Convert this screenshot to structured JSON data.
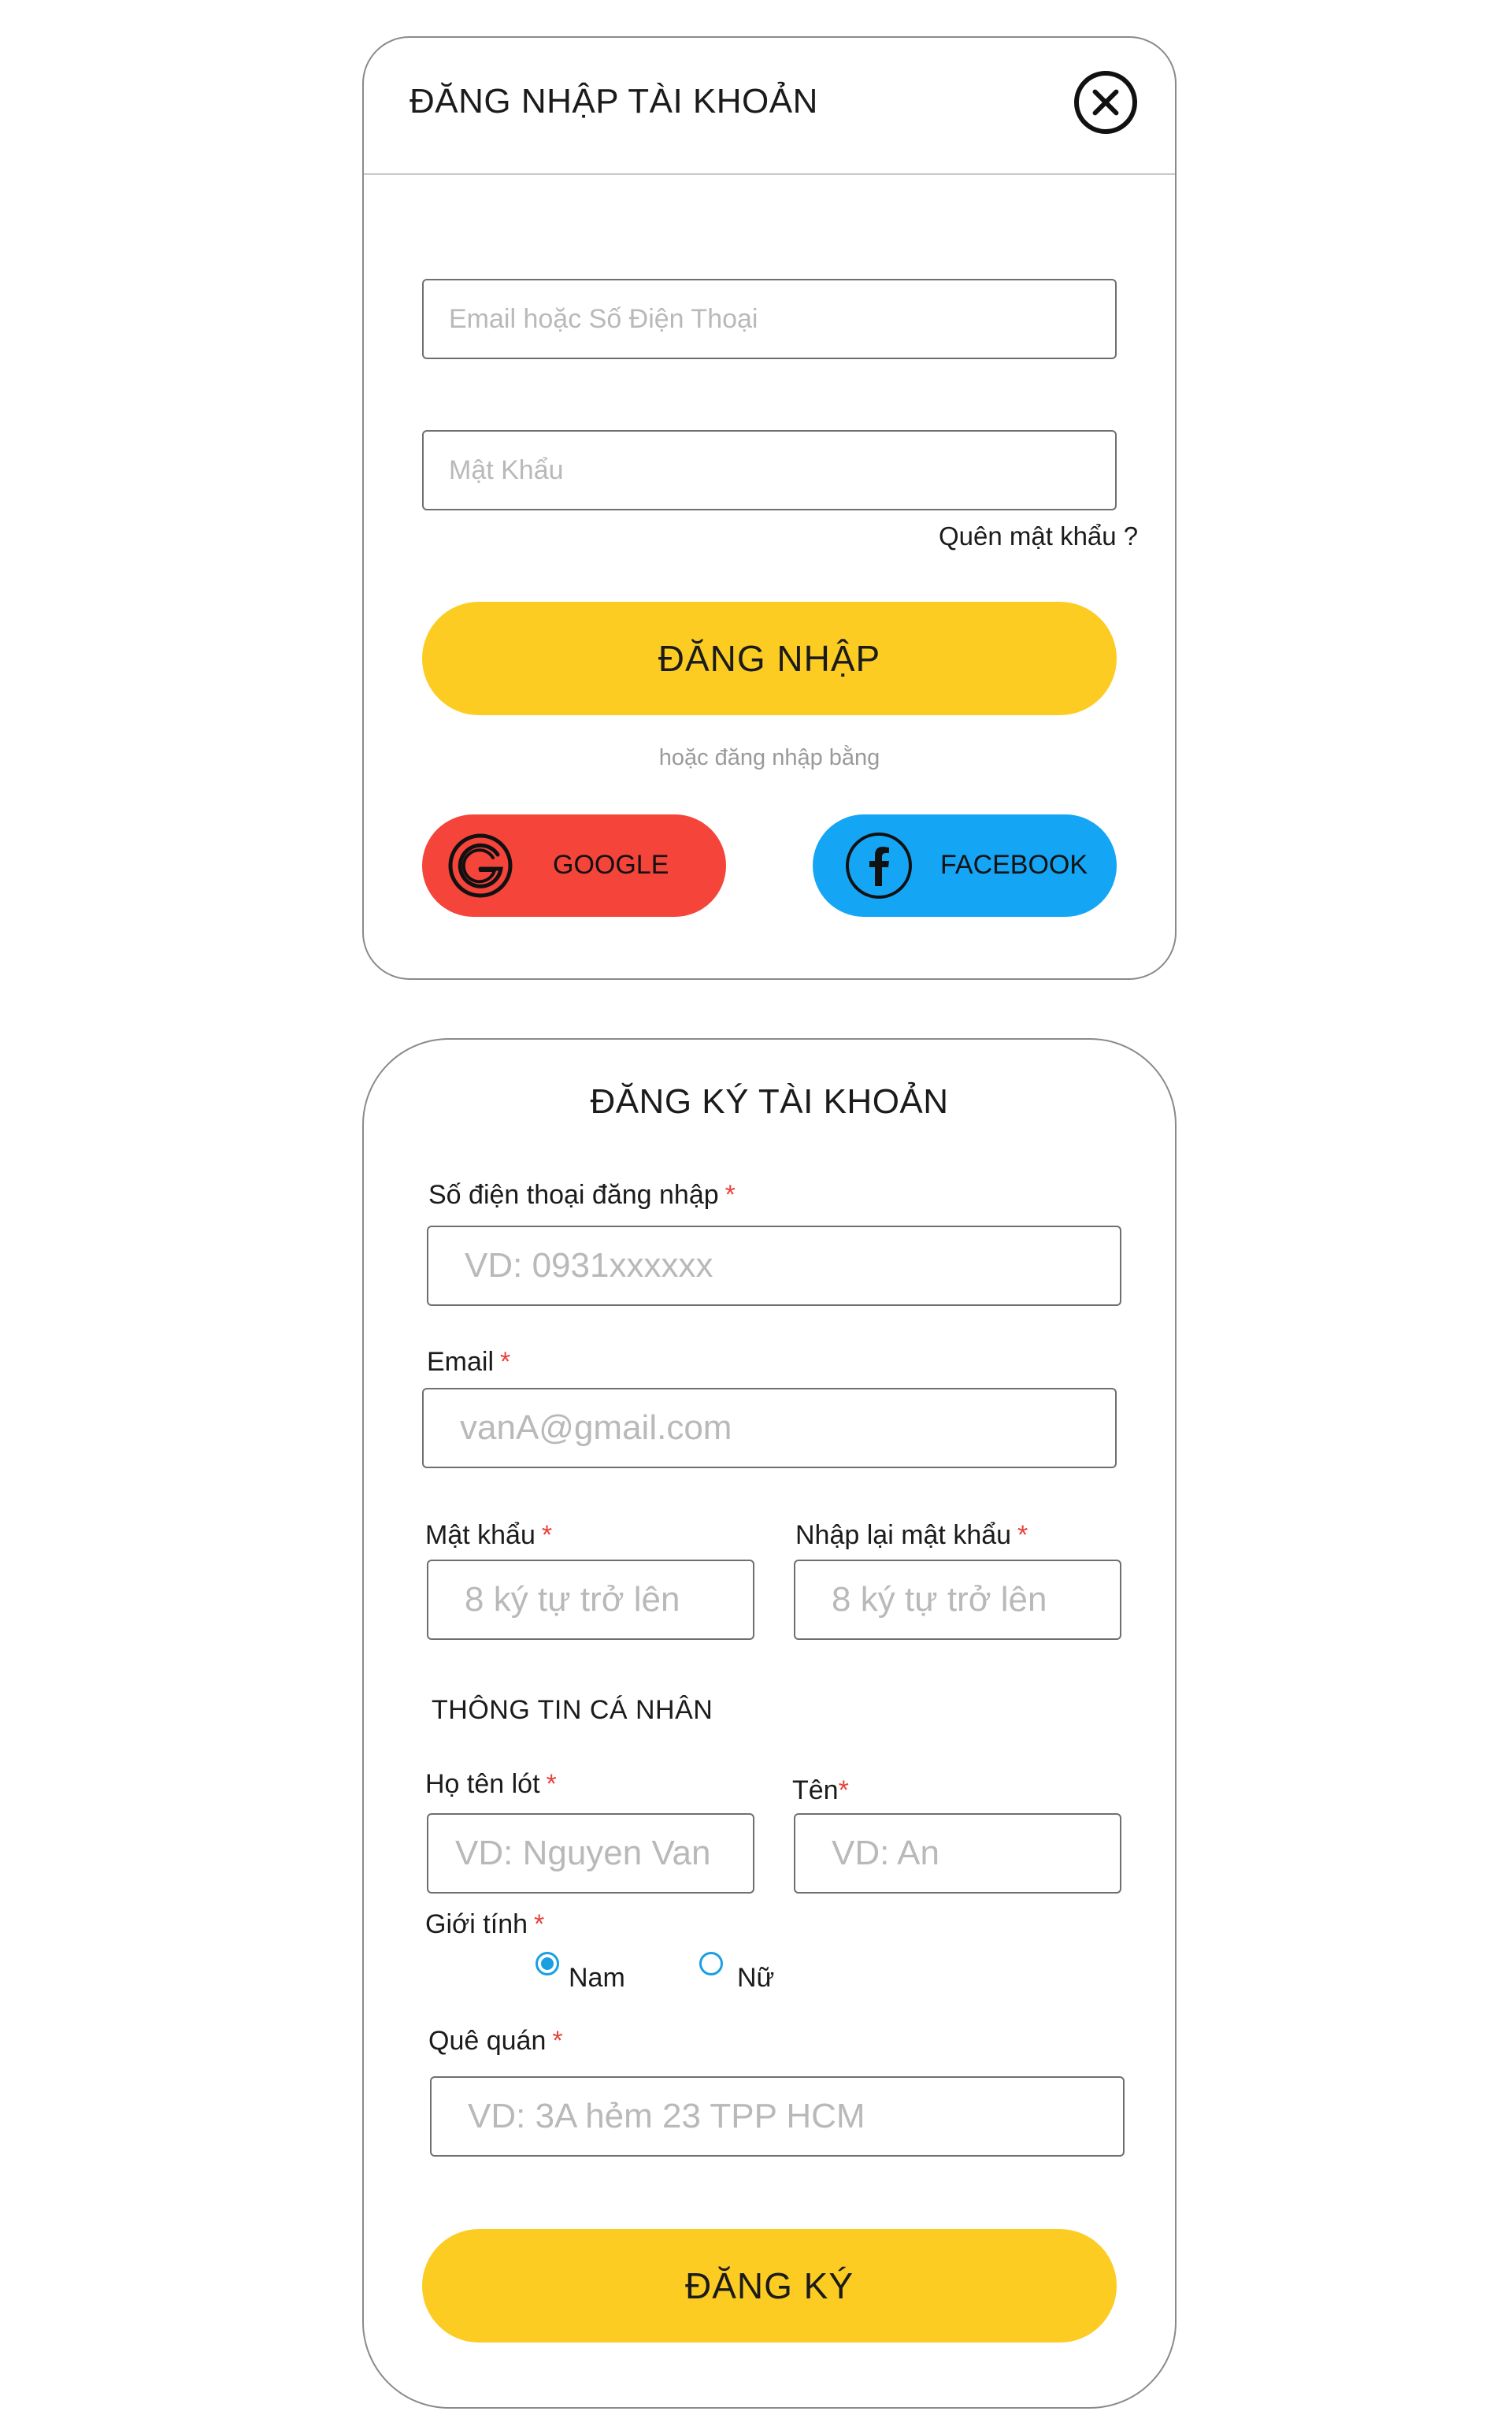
{
  "login": {
    "title": "ĐĂNG NHẬP TÀI KHOẢN",
    "email_placeholder": "Email hoặc Số Điện Thoại",
    "password_placeholder": "Mật Khẩu",
    "forgot_password": "Quên mật khẩu ?",
    "submit_label": "ĐĂNG NHẬP",
    "or_text": "hoặc đăng nhập bằng",
    "google_label": "GOOGLE",
    "facebook_label": "FACEBOOK"
  },
  "register": {
    "title": "ĐĂNG KÝ TÀI KHOẢN",
    "required_mark": "*",
    "phone": {
      "label": "Số điện thoại đăng nhập",
      "placeholder": "VD: 0931xxxxxx"
    },
    "email": {
      "label": "Email",
      "placeholder": "vanA@gmail.com"
    },
    "password": {
      "label": "Mật khẩu",
      "placeholder": "8 ký tự trở lên"
    },
    "password_confirm": {
      "label": "Nhập lại mật khẩu",
      "placeholder": "8 ký tự trở lên"
    },
    "section_personal": "THÔNG TIN CÁ NHÂN",
    "last_middle_name": {
      "label": "Họ tên lót",
      "placeholder": "VD: Nguyen Van"
    },
    "first_name": {
      "label": "Tên",
      "placeholder": "VD: An"
    },
    "gender": {
      "label": "Giới tính",
      "options": [
        "Nam",
        "Nữ"
      ],
      "selected": "Nam"
    },
    "hometown": {
      "label": "Quê quán",
      "placeholder": "VD: 3A hẻm 23 TPP HCM"
    },
    "submit_label": "ĐĂNG KÝ"
  },
  "colors": {
    "primary_button": "#fccc23",
    "google": "#f5443a",
    "facebook": "#14a5f5",
    "required": "#e8413b",
    "radio": "#1a9fe0"
  },
  "icons": [
    "close-icon",
    "google-icon",
    "facebook-icon"
  ]
}
